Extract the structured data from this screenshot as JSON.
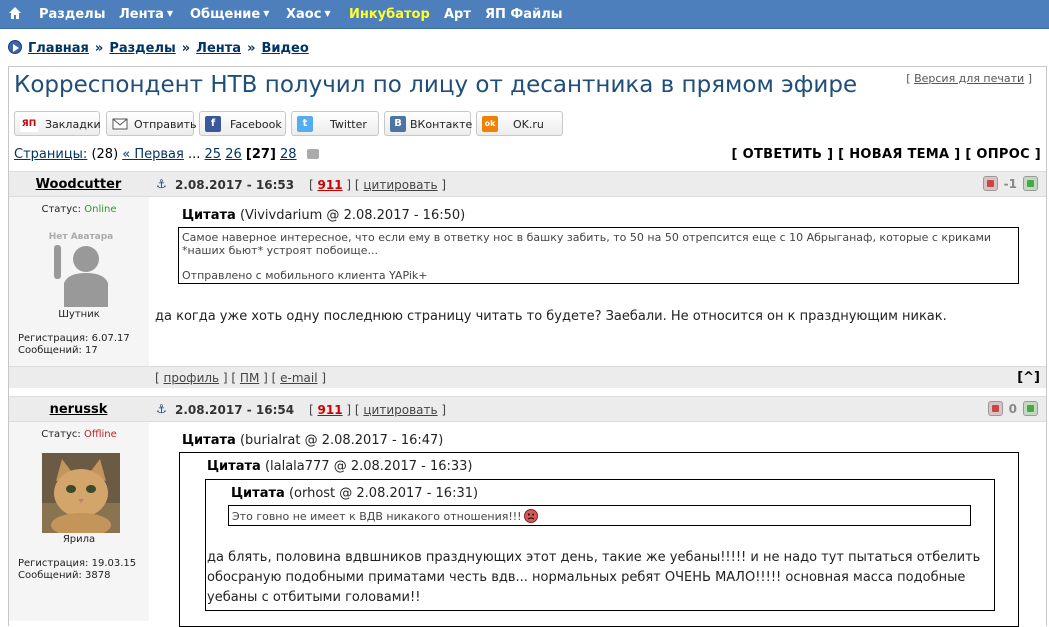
{
  "topnav": {
    "items": [
      "Разделы",
      "Лента",
      "Общение",
      "Хаос",
      "Инкубатор",
      "Арт",
      "ЯП Файлы"
    ],
    "arrow": "▼"
  },
  "breadcrumb": {
    "items": [
      "Главная",
      "Разделы",
      "Лента",
      "Видео"
    ],
    "sep": "»"
  },
  "page_title": "Корреспондент НТВ получил по лицу от десантника в прямом эфире",
  "print_version": "Версия для печати",
  "share": {
    "buttons": [
      {
        "label": "Закладки",
        "icon": "ЯП"
      },
      {
        "label": "Отправить",
        "icon": "mail-icon"
      },
      {
        "label": "Facebook",
        "icon": "f"
      },
      {
        "label": "Twitter",
        "icon": "t"
      },
      {
        "label": "ВКонтакте",
        "icon": "B"
      },
      {
        "label": "OK.ru",
        "icon": "ok"
      }
    ]
  },
  "pagination": {
    "label": "Страницы:",
    "total": "(28)",
    "first": "« Первая",
    "ellipsis": "...",
    "p25": "25",
    "p26": "26",
    "current": "[27]",
    "p28": "28"
  },
  "actions": {
    "reply": "[ ОТВЕТИТЬ ]",
    "new_topic": "[ НОВАЯ ТЕМА ]",
    "poll": "[ ОПРОС ]"
  },
  "post1": {
    "author": "Woodcutter",
    "date": "2.08.2017 - 16:53",
    "number": "911",
    "quote_link": "цитировать",
    "rating": "-1",
    "status_label": "Статус:",
    "status": "Online",
    "avatar_text": "Нет Аватара",
    "user_title": "Шутник",
    "reg": "Регистрация: 6.07.17",
    "msgs": "Сообщений: 17",
    "quote_word": "Цитата",
    "quote_src": "(Vivivdarium @ 2.08.2017 - 16:50)",
    "quote_line1": "Самое наверное интересное, что если ему в ответку нос в башку забить, то 50 на 50 отрепсится еще с 10 Абрыганаф, которые с криками",
    "quote_line2": "*наших бьют* устроят побоище...",
    "quote_footer": "Отправлено с мобильного клиента YAPik+",
    "text": "да когда уже хоть одну последнюю страницу читать то будете? Заебали. Не относится он к празднующим никак.",
    "foot_profile": "профиль",
    "foot_pm": "ПМ",
    "foot_email": "e-mail",
    "foot_up": "[^]"
  },
  "post2": {
    "author": "nerussk",
    "date": "2.08.2017 - 16:54",
    "number": "911",
    "quote_link": "цитировать",
    "rating": "0",
    "status_label": "Статус:",
    "status": "Offline",
    "user_title": "Ярила",
    "reg": "Регистрация: 19.03.15",
    "msgs": "Сообщений: 3878",
    "q1_word": "Цитата",
    "q1_src": "(burialrat @ 2.08.2017 - 16:47)",
    "q2_word": "Цитата",
    "q2_src": "(lalala777 @ 2.08.2017 - 16:33)",
    "q3_word": "Цитата",
    "q3_src": "(orhost @ 2.08.2017 - 16:31)",
    "q3_text": "Это говно не имеет к ВДВ никакого отношения!!!",
    "q2_line1": "да блять, половина вдвшников празднующих этот день, такие же уебаны!!!!! и не надо тут пытаться отбелить",
    "q2_line2": "обосраную подобными приматами честь вдв... нормальных ребят ОЧЕНЬ МАЛО!!!!! основная масса подобные",
    "q2_line3": "уебаны с отбитыми головами!!"
  }
}
